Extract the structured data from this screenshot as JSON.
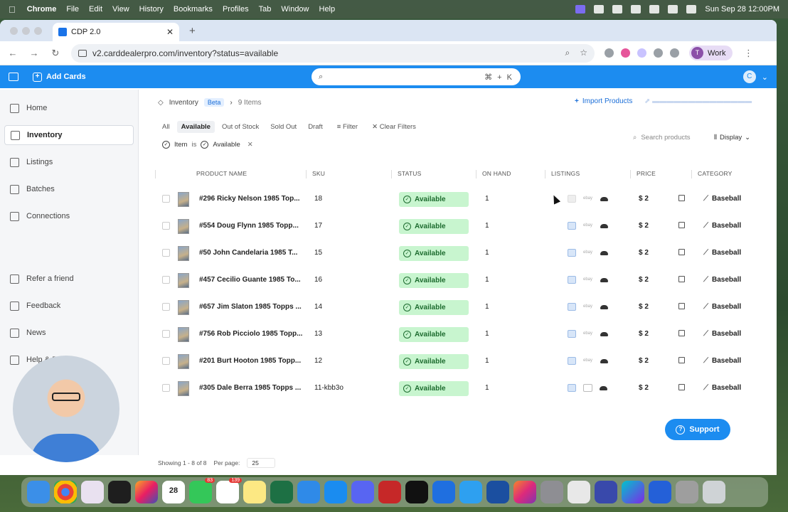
{
  "menubar": {
    "items": [
      "Chrome",
      "File",
      "Edit",
      "View",
      "History",
      "Bookmarks",
      "Profiles",
      "Tab",
      "Window",
      "Help"
    ],
    "datetime": "Sun Sep 28  12:00PM"
  },
  "browser": {
    "tab_title": "CDP 2.0",
    "url": "v2.carddealerpro.com/inventory?status=available",
    "profile_initial": "T",
    "profile_label": "Work"
  },
  "app": {
    "add_cards": "Add Cards",
    "search_shortcut": "⌘ + K",
    "user_initial": "C"
  },
  "sidebar": {
    "items": [
      {
        "label": "Home",
        "icon": "home-icon"
      },
      {
        "label": "Inventory",
        "icon": "tag-icon",
        "active": true
      },
      {
        "label": "Listings",
        "icon": "list-icon"
      },
      {
        "label": "Batches",
        "icon": "folder-icon"
      },
      {
        "label": "Connections",
        "icon": "connections-icon"
      }
    ],
    "bottom_items": [
      {
        "label": "Refer a friend",
        "icon": "gift-icon"
      },
      {
        "label": "Feedback",
        "icon": "message-icon"
      },
      {
        "label": "News",
        "icon": "news-icon"
      },
      {
        "label": "Help & Docs",
        "icon": "help-icon"
      }
    ]
  },
  "main": {
    "breadcrumb": "Inventory",
    "beta": "Beta",
    "item_count": "9 Items",
    "import_label": "Import Products",
    "filter_tabs": [
      "All",
      "Available",
      "Out of Stock",
      "Sold Out",
      "Draft"
    ],
    "filter_button": "Filter",
    "clear_filters": "Clear Filters",
    "search_placeholder": "Search products",
    "display_label": "Display",
    "chip": {
      "field": "Item",
      "op": "is",
      "value": "Available"
    },
    "columns": [
      "PRODUCT NAME",
      "SKU",
      "STATUS",
      "ON HAND",
      "LISTINGS",
      "PRICE",
      "CATEGORY"
    ],
    "rows": [
      {
        "name": "#296 Ricky Nelson 1985 Top...",
        "sku": "18",
        "status": "Available",
        "on_hand": "1",
        "price": "$ 2",
        "category": "Baseball"
      },
      {
        "name": "#554 Doug Flynn 1985 Topp...",
        "sku": "17",
        "status": "Available",
        "on_hand": "1",
        "price": "$ 2",
        "category": "Baseball"
      },
      {
        "name": "#50 John Candelaria 1985 T...",
        "sku": "15",
        "status": "Available",
        "on_hand": "1",
        "price": "$ 2",
        "category": "Baseball"
      },
      {
        "name": "#457 Cecilio Guante 1985 To...",
        "sku": "16",
        "status": "Available",
        "on_hand": "1",
        "price": "$ 2",
        "category": "Baseball"
      },
      {
        "name": "#657 Jim Slaton 1985 Topps ...",
        "sku": "14",
        "status": "Available",
        "on_hand": "1",
        "price": "$ 2",
        "category": "Baseball"
      },
      {
        "name": "#756 Rob Picciolo 1985 Topp...",
        "sku": "13",
        "status": "Available",
        "on_hand": "1",
        "price": "$ 2",
        "category": "Baseball"
      },
      {
        "name": "#201 Burt Hooton 1985 Topp...",
        "sku": "12",
        "status": "Available",
        "on_hand": "1",
        "price": "$ 2",
        "category": "Baseball"
      },
      {
        "name": "#305 Dale Berra 1985 Topps ...",
        "sku": "11-kbb3o",
        "status": "Available",
        "on_hand": "1",
        "price": "$ 2",
        "category": "Baseball"
      }
    ],
    "showing": "Showing 1 - 8 of 8",
    "per_page_label": "Per page:",
    "per_page_value": "25",
    "support": "Support"
  },
  "dock": {
    "calendar_month": "SEP",
    "calendar_day": "28",
    "messages_badge": "83",
    "reminders_badge": "139"
  },
  "colors": {
    "accent": "#1c8cf0",
    "available_bg": "#c8f5cf",
    "available_text": "#1c6b2e"
  }
}
